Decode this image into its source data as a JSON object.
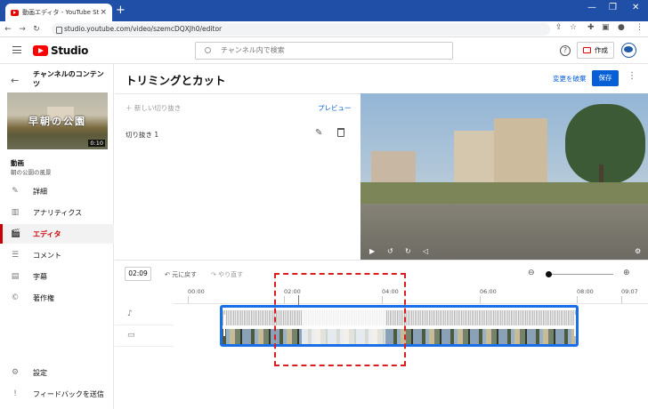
{
  "browser": {
    "tab_title": "動画エディタ - YouTube Studio",
    "tab_close": "×",
    "new_tab": "+",
    "url": "studio.youtube.com/video/szemcDQXJh0/editor",
    "win_min": "—",
    "win_max": "❐",
    "win_close": "✕"
  },
  "header": {
    "brand": "Studio",
    "search_placeholder": "チャンネル内で検索",
    "help": "?",
    "create_label": "作成"
  },
  "sidebar": {
    "back": "←",
    "channel_title": "チャンネルのコンテンツ",
    "thumbnail_text": "早朝の公園",
    "thumbnail_duration": "0:10",
    "video_label": "動画",
    "video_name": "朝の公園の風景",
    "items": [
      {
        "label": "詳細",
        "icon": "✎"
      },
      {
        "label": "アナリティクス",
        "icon": "▥"
      },
      {
        "label": "エディタ",
        "icon": "🎬"
      },
      {
        "label": "コメント",
        "icon": "☰"
      },
      {
        "label": "字幕",
        "icon": "▤"
      },
      {
        "label": "著作権",
        "icon": "©"
      },
      {
        "label": "設定",
        "icon": "⚙"
      },
      {
        "label": "フィードバックを送信",
        "icon": "!"
      }
    ]
  },
  "editor": {
    "title": "トリミングとカット",
    "discard_label": "変更を破棄",
    "save_label": "保存",
    "new_cut_label": "＋ 新しい切り抜き",
    "preview_label": "プレビュー",
    "cut_item_label": "切り抜き 1",
    "timecode": "02:09",
    "undo_label": "元に戻す",
    "redo_label": "やり直す",
    "ruler_ticks": [
      "00:00",
      "02:00",
      "04:00",
      "06:00",
      "08:00",
      "09:07"
    ],
    "zoom_level": 0
  },
  "colors": {
    "accent": "#065fd4",
    "brand_red": "#ff0000",
    "clip_border": "#1a6ee8",
    "annotation": "#d81e1e"
  }
}
